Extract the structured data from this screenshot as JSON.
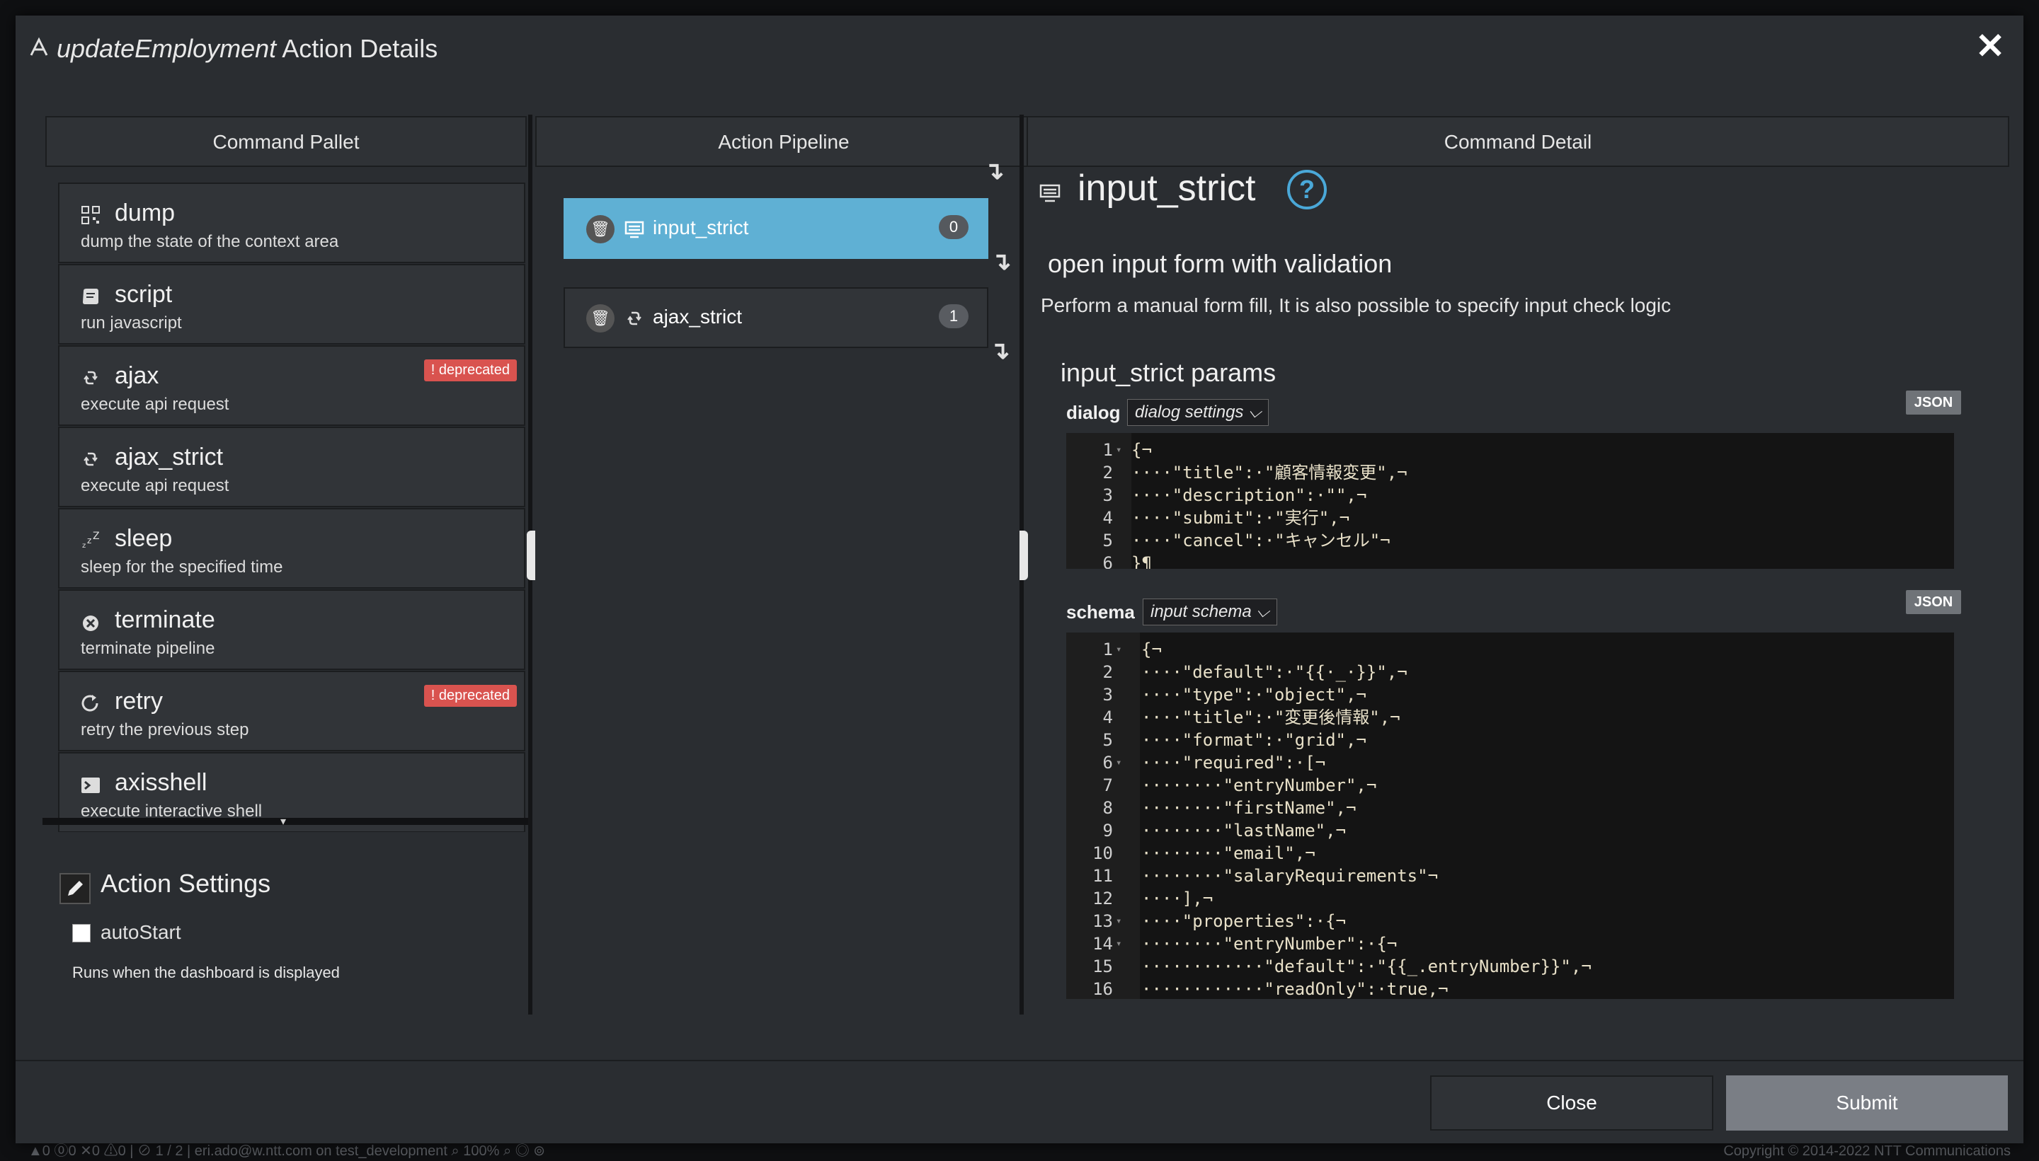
{
  "background": {
    "status_left": "▲0 ⓪0 ✕0 ⚠0 | ⊘ 1 / 2 |  eri.ado@w.ntt.com  on  test_development    ⌕ 100%  ⌕   ◎ ⊚",
    "status_right": "Copyright © 2014-2022 NTT Communications"
  },
  "modal": {
    "title_italic": "updateEmployment",
    "title_rest": " Action Details",
    "close_symbol": "✕"
  },
  "columns": {
    "pallet_header": "Command Pallet",
    "pipeline_header": "Action Pipeline",
    "detail_header": "Command Detail"
  },
  "pallet": {
    "items": [
      {
        "name": "dump",
        "desc": "dump the state of the context area",
        "icon": "qr-icon"
      },
      {
        "name": "script",
        "desc": "run javascript",
        "icon": "script-icon"
      },
      {
        "name": "ajax",
        "desc": "execute api request",
        "icon": "sync-icon",
        "badge": "! deprecated"
      },
      {
        "name": "ajax_strict",
        "desc": "execute api request",
        "icon": "sync-icon"
      },
      {
        "name": "sleep",
        "desc": "sleep for the specified time",
        "icon": "sleep-icon"
      },
      {
        "name": "terminate",
        "desc": "terminate pipeline",
        "icon": "terminate-icon"
      },
      {
        "name": "retry",
        "desc": "retry the previous step",
        "icon": "retry-icon",
        "badge": "! deprecated"
      },
      {
        "name": "axisshell",
        "desc": "execute interactive shell",
        "icon": "terminal-icon"
      }
    ],
    "scroll_symbol": "▾"
  },
  "settings": {
    "title": "Action Settings",
    "autostart_label": "autoStart",
    "autostart_checked": false,
    "autostart_desc": "Runs when the dashboard is displayed"
  },
  "pipeline": {
    "items": [
      {
        "name": "input_strict",
        "index": "0",
        "active": true
      },
      {
        "name": "ajax_strict",
        "index": "1",
        "active": false
      }
    ],
    "arrow_symbol": "↴"
  },
  "detail": {
    "name": "input_strict",
    "help_symbol": "?",
    "subtitle": "open input form with validation",
    "description": "Perform a manual form fill, It is also possible to specify input check logic",
    "params_title": "input_strict params",
    "json_label": "JSON",
    "dialog": {
      "label": "dialog",
      "select_value": "dialog settings ⌵",
      "lines": [
        {
          "n": "1",
          "fold": "▾",
          "t": "{¬"
        },
        {
          "n": "2",
          "fold": "",
          "t": "····\"title\":·\"顧客情報変更\",¬"
        },
        {
          "n": "3",
          "fold": "",
          "t": "····\"description\":·\"\",¬"
        },
        {
          "n": "4",
          "fold": "",
          "t": "····\"submit\":·\"実行\",¬"
        },
        {
          "n": "5",
          "fold": "",
          "t": "····\"cancel\":·\"キャンセル\"¬"
        },
        {
          "n": "6",
          "fold": "",
          "t": "}¶"
        }
      ]
    },
    "schema": {
      "label": "schema",
      "select_value": "input schema ⌵",
      "lines": [
        {
          "n": "1",
          "fold": "▾",
          "t": "{¬"
        },
        {
          "n": "2",
          "fold": "",
          "t": "····\"default\":·\"{{·_·}}\",¬"
        },
        {
          "n": "3",
          "fold": "",
          "t": "····\"type\":·\"object\",¬"
        },
        {
          "n": "4",
          "fold": "",
          "t": "····\"title\":·\"変更後情報\",¬"
        },
        {
          "n": "5",
          "fold": "",
          "t": "····\"format\":·\"grid\",¬"
        },
        {
          "n": "6",
          "fold": "▾",
          "t": "····\"required\":·[¬"
        },
        {
          "n": "7",
          "fold": "",
          "t": "········\"entryNumber\",¬"
        },
        {
          "n": "8",
          "fold": "",
          "t": "········\"firstName\",¬"
        },
        {
          "n": "9",
          "fold": "",
          "t": "········\"lastName\",¬"
        },
        {
          "n": "10",
          "fold": "",
          "t": "········\"email\",¬"
        },
        {
          "n": "11",
          "fold": "",
          "t": "········\"salaryRequirements\"¬"
        },
        {
          "n": "12",
          "fold": "",
          "t": "····],¬"
        },
        {
          "n": "13",
          "fold": "▾",
          "t": "····\"properties\":·{¬"
        },
        {
          "n": "14",
          "fold": "▾",
          "t": "········\"entryNumber\":·{¬"
        },
        {
          "n": "15",
          "fold": "",
          "t": "············\"default\":·\"{{_.entryNumber}}\",¬"
        },
        {
          "n": "16",
          "fold": "",
          "t": "············\"readOnly\":·true,¬"
        }
      ]
    }
  },
  "footer": {
    "close_label": "Close",
    "submit_label": "Submit"
  },
  "colors": {
    "active_pipeline": "#5fb0d4",
    "deprecated_badge": "#d9534f",
    "help_icon": "#4aa8d8",
    "submit_button": "#7a7e85"
  }
}
